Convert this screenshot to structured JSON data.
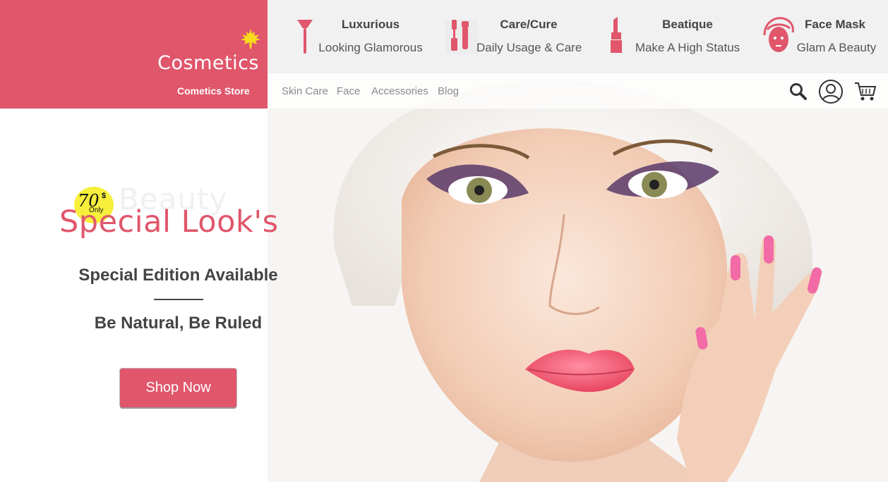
{
  "brand": {
    "name": "Cosmetics",
    "subtitle": "Cometics Store"
  },
  "features": [
    {
      "title": "Luxurious",
      "subtitle": "Looking Glamorous",
      "icon": "brush-icon"
    },
    {
      "title": "Care/Cure",
      "subtitle": "Daily Usage & Care",
      "icon": "mascara-icon"
    },
    {
      "title": "Beatique",
      "subtitle": "Make A High Status",
      "icon": "lipstick-icon"
    },
    {
      "title": "Face Mask",
      "subtitle": "Glam A Beauty",
      "icon": "face-mask-icon"
    }
  ],
  "nav": {
    "links": [
      "Skin Care",
      "Face",
      "Accessories",
      "Blog"
    ],
    "icons": [
      "search-icon",
      "user-icon",
      "cart-icon"
    ]
  },
  "promo": {
    "price": "70",
    "currency": "$",
    "price_note": "Only",
    "ghost_text": "Beauty",
    "title": "Special Look's",
    "subtitle": "Special Edition Available",
    "tagline": "Be Natural, Be Ruled",
    "button": "Shop Now"
  },
  "colors": {
    "accent": "#e0566b",
    "badge": "#f7ef3c",
    "text": "#444444"
  }
}
